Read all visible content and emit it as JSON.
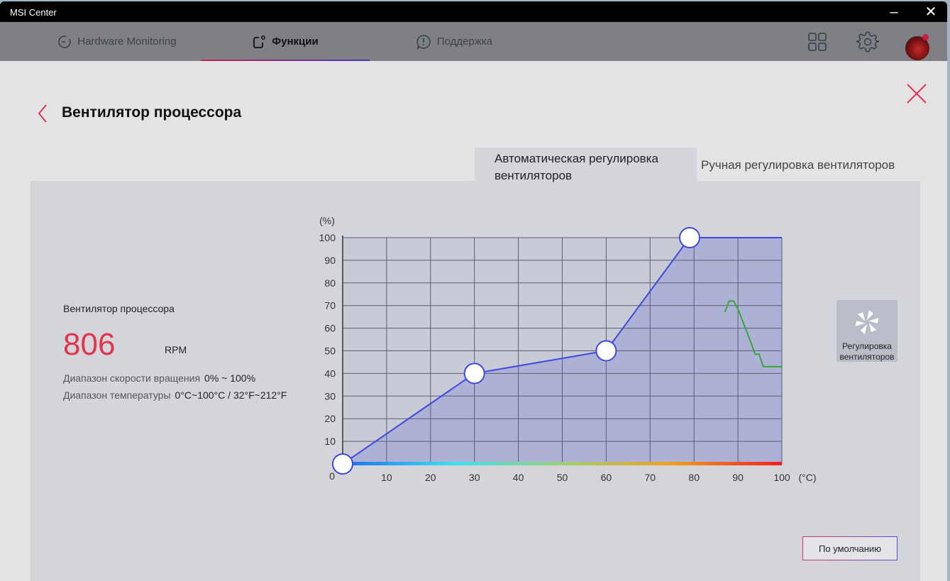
{
  "window": {
    "title": "MSI Center",
    "minimize": "–",
    "close": "✕"
  },
  "nav": {
    "tabs": [
      {
        "label": "Hardware Monitoring"
      },
      {
        "label": "Функции"
      },
      {
        "label": "Поддержка"
      }
    ]
  },
  "page": {
    "title": "Вентилятор процессора"
  },
  "mode_tabs": {
    "auto": "Автоматическая регулировка вентиляторов",
    "manual": "Ручная регулировка вентиляторов"
  },
  "info": {
    "name": "Вентилятор процессора",
    "rpm": "806",
    "rpm_unit": "RPM",
    "speed_range_label": "Диапазон скорости вращения",
    "speed_range": "0% ~ 100%",
    "temp_range_label": "Диапазон температуры",
    "temp_range": "0°C~100°C / 32°F~212°F"
  },
  "fan_control_button": "Регулировка вентиляторов",
  "default_button": "По умолчанию",
  "colors": {
    "accent": "#e2344e",
    "curve": "#3f49e0",
    "temp": "#3aa53a"
  },
  "chart_data": {
    "type": "line",
    "ylabel": "(%)",
    "xlabel": "(°C)",
    "xlim": [
      0,
      100
    ],
    "ylim": [
      0,
      100
    ],
    "x_ticks": [
      10,
      20,
      30,
      40,
      50,
      60,
      70,
      80,
      90,
      100
    ],
    "y_ticks": [
      10,
      20,
      30,
      40,
      50,
      60,
      70,
      80,
      90,
      100
    ],
    "origin_label": "0",
    "series": [
      {
        "name": "fan-curve",
        "points": [
          [
            0,
            0
          ],
          [
            30,
            40
          ],
          [
            60,
            50
          ],
          [
            79,
            100
          ]
        ]
      },
      {
        "name": "temperature-history",
        "points": [
          [
            87,
            67
          ],
          [
            88,
            72
          ],
          [
            89,
            72
          ],
          [
            90,
            68.5
          ],
          [
            91.9,
            59
          ],
          [
            92.9,
            54
          ],
          [
            93.9,
            48.5
          ],
          [
            94.8,
            48.5
          ],
          [
            95.8,
            43
          ],
          [
            100,
            43
          ]
        ]
      }
    ]
  }
}
